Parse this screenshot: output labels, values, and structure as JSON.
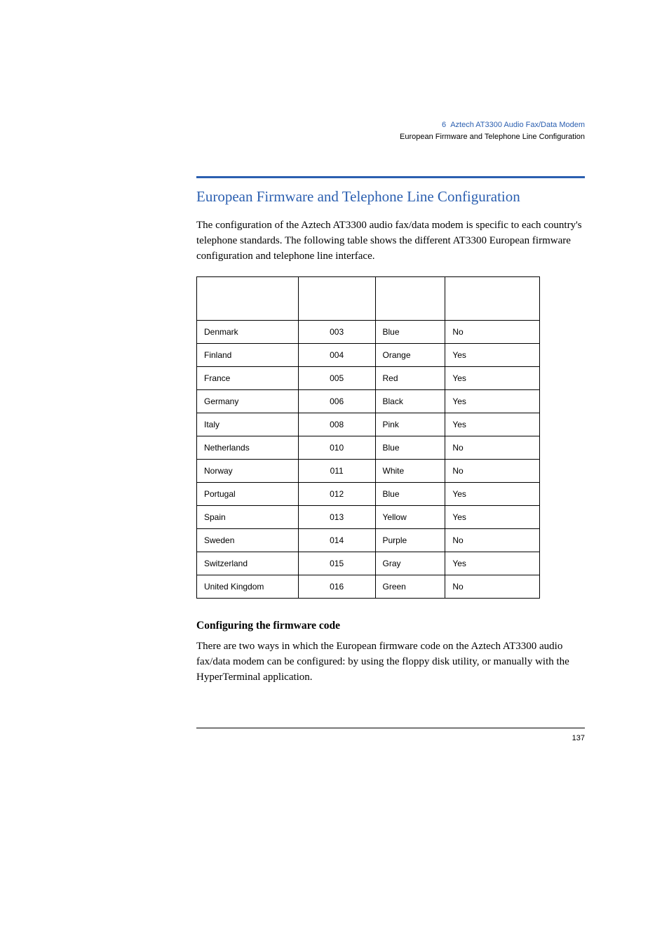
{
  "header": {
    "chapter_num": "6",
    "chapter_title": "Aztech AT3300 Audio Fax/Data Modem",
    "subtitle": "European Firmware and Telephone Line Configuration"
  },
  "section": {
    "title": "European Firmware and Telephone Line Configuration",
    "intro": "The configuration of the Aztech AT3300 audio fax/data modem is specific to each country's telephone standards. The following table shows the different AT3300 European firmware configuration and telephone line interface."
  },
  "table": {
    "rows": [
      {
        "country": "Denmark",
        "code": "003",
        "color": "Blue",
        "interface": "No"
      },
      {
        "country": "Finland",
        "code": "004",
        "color": "Orange",
        "interface": "Yes"
      },
      {
        "country": "France",
        "code": "005",
        "color": "Red",
        "interface": "Yes"
      },
      {
        "country": "Germany",
        "code": "006",
        "color": "Black",
        "interface": "Yes"
      },
      {
        "country": "Italy",
        "code": "008",
        "color": "Pink",
        "interface": "Yes"
      },
      {
        "country": "Netherlands",
        "code": "010",
        "color": "Blue",
        "interface": "No"
      },
      {
        "country": "Norway",
        "code": "011",
        "color": "White",
        "interface": "No"
      },
      {
        "country": "Portugal",
        "code": "012",
        "color": "Blue",
        "interface": "Yes"
      },
      {
        "country": "Spain",
        "code": "013",
        "color": "Yellow",
        "interface": "Yes"
      },
      {
        "country": "Sweden",
        "code": "014",
        "color": "Purple",
        "interface": "No"
      },
      {
        "country": "Switzerland",
        "code": "015",
        "color": "Gray",
        "interface": "Yes"
      },
      {
        "country": "United Kingdom",
        "code": "016",
        "color": "Green",
        "interface": "No"
      }
    ]
  },
  "subsection": {
    "heading": "Configuring the firmware code",
    "body": "There are two ways in which the European firmware code on the Aztech AT3300 audio fax/data modem can be configured: by using the floppy disk utility, or manually with the HyperTerminal application."
  },
  "footer": {
    "page_number": "137"
  }
}
